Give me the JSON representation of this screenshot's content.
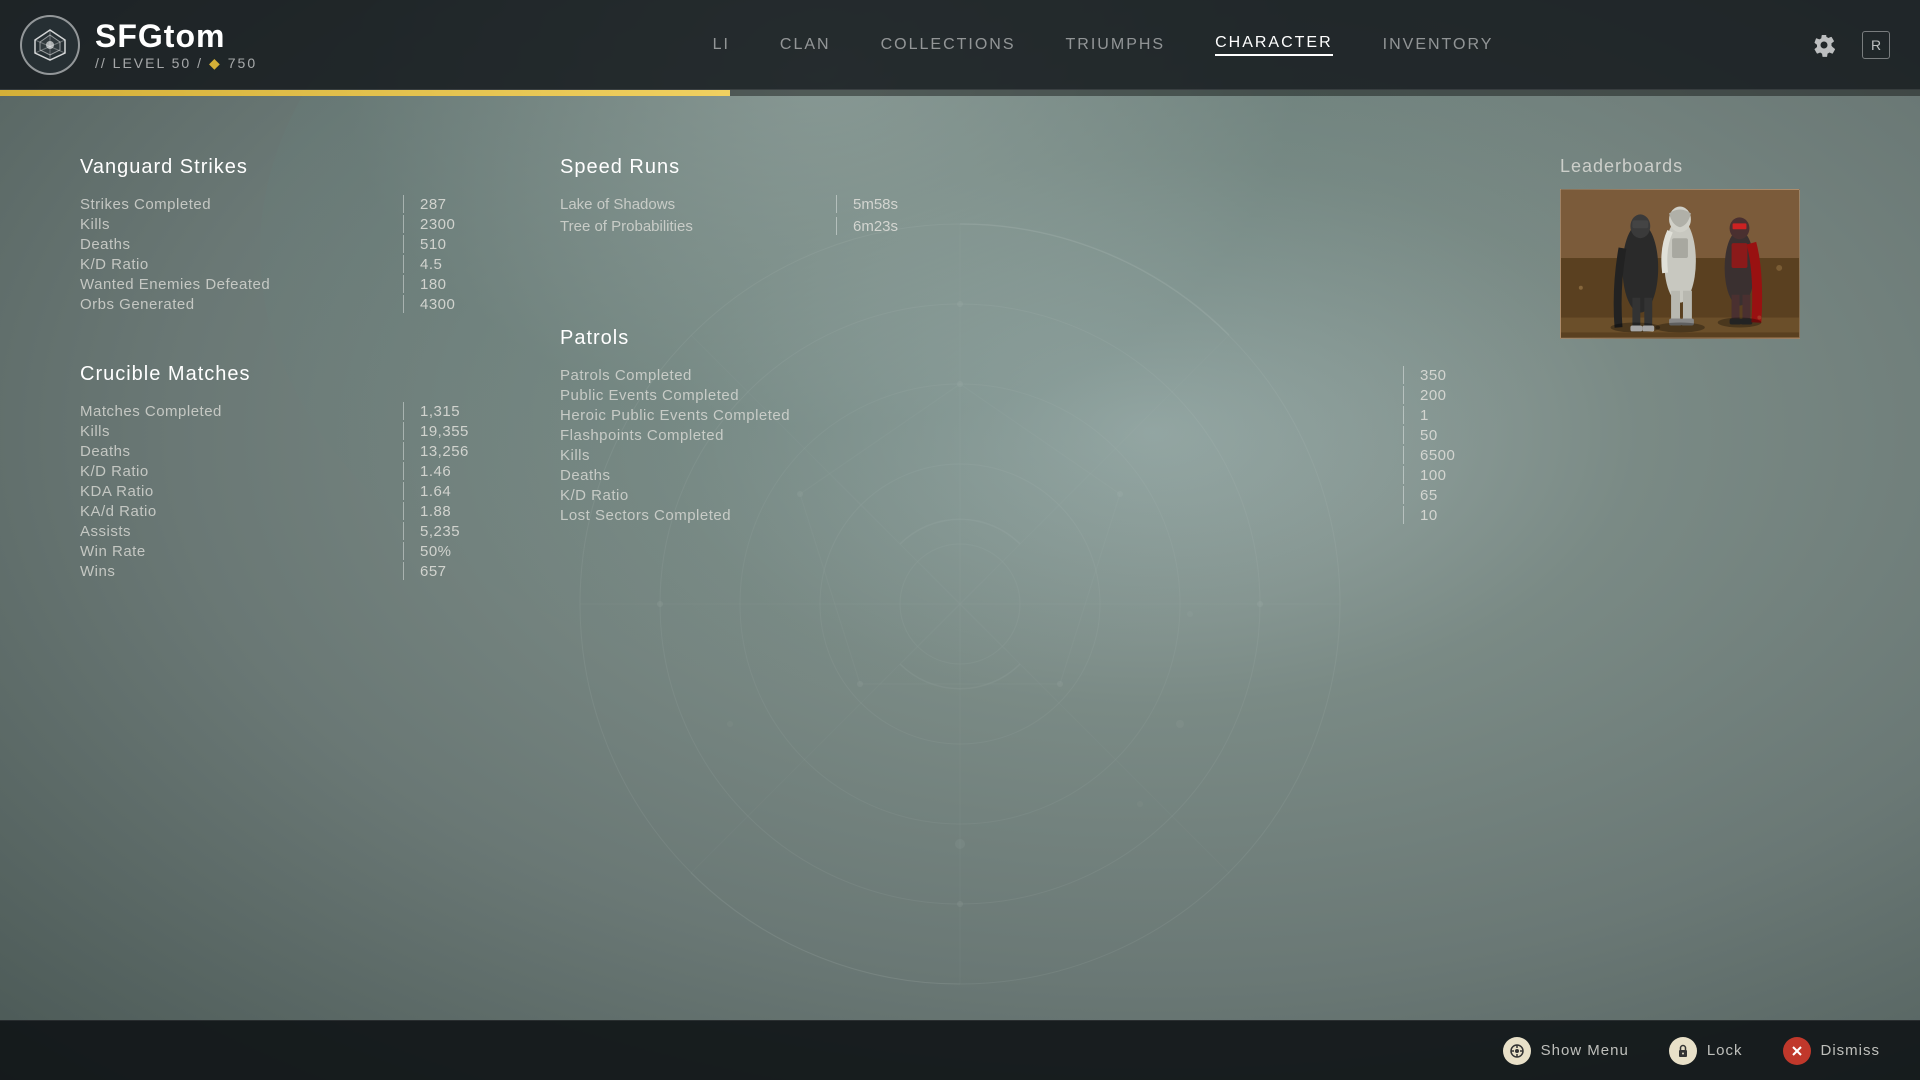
{
  "header": {
    "player_name": "SFGtom",
    "level_label": "// LEVEL 50 /",
    "light_icon": "◆",
    "light_value": "750",
    "xp_fill_percent": "38%",
    "nav_items": [
      {
        "id": "li",
        "label": "LI"
      },
      {
        "id": "clan",
        "label": "CLAN"
      },
      {
        "id": "collections",
        "label": "COLLECTIONS"
      },
      {
        "id": "triumphs",
        "label": "TRIUMPHS"
      },
      {
        "id": "character",
        "label": "CHARACTER",
        "active": true
      },
      {
        "id": "inventory",
        "label": "INVENTORY"
      }
    ],
    "settings_icon": "⚙",
    "record_icon": "R"
  },
  "vanguard_strikes": {
    "title": "Vanguard Strikes",
    "stats": [
      {
        "label": "Strikes Completed",
        "value": "287"
      },
      {
        "label": "Kills",
        "value": "2300"
      },
      {
        "label": "Deaths",
        "value": "510"
      },
      {
        "label": "K/D Ratio",
        "value": "4.5"
      },
      {
        "label": "Wanted Enemies Defeated",
        "value": "180"
      },
      {
        "label": "Orbs Generated",
        "value": "4300"
      }
    ]
  },
  "crucible_matches": {
    "title": "Crucible Matches",
    "stats": [
      {
        "label": "Matches Completed",
        "value": "1,315"
      },
      {
        "label": "Kills",
        "value": "19,355"
      },
      {
        "label": "Deaths",
        "value": "13,256"
      },
      {
        "label": "K/D Ratio",
        "value": "1.46"
      },
      {
        "label": "KDA Ratio",
        "value": "1.64"
      },
      {
        "label": "KA/d Ratio",
        "value": "1.88"
      },
      {
        "label": "Assists",
        "value": "5,235"
      },
      {
        "label": "Win Rate",
        "value": "50%"
      },
      {
        "label": "Wins",
        "value": "657"
      }
    ]
  },
  "speed_runs": {
    "title": "Speed Runs",
    "runs": [
      {
        "label": "Lake of Shadows",
        "value": "5m58s"
      },
      {
        "label": "Tree of Probabilities",
        "value": "6m23s"
      }
    ]
  },
  "patrols": {
    "title": "Patrols",
    "stats": [
      {
        "label": "Patrols Completed",
        "value": "350"
      },
      {
        "label": "Public Events Completed",
        "value": "200"
      },
      {
        "label": "Heroic Public Events Completed",
        "value": "1"
      },
      {
        "label": "Flashpoints Completed",
        "value": "50"
      },
      {
        "label": "Kills",
        "value": "6500"
      },
      {
        "label": "Deaths",
        "value": "100"
      },
      {
        "label": "K/D Ratio",
        "value": "65"
      },
      {
        "label": "Lost Sectors Completed",
        "value": "10"
      }
    ]
  },
  "leaderboards": {
    "title": "Leaderboards"
  },
  "footer": {
    "show_menu_label": "Show Menu",
    "lock_label": "Lock",
    "dismiss_label": "Dismiss"
  }
}
